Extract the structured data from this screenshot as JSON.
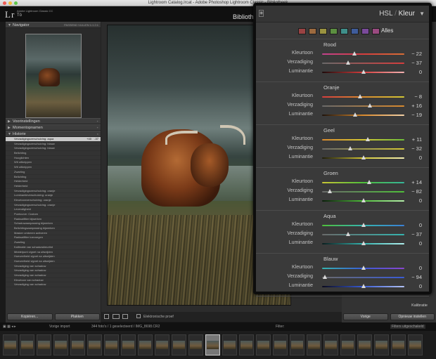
{
  "window": {
    "title": "Lightroom Catalog.lrcat - Adobe Photoshop Lightroom Classic - Bibliotheek"
  },
  "identity": {
    "logo": "Lr",
    "app_name": "Adobe Lightroom Classic CC",
    "user": "Tó",
    "module": "Biblioth"
  },
  "left_panel": {
    "navigator": {
      "label": "Navigator",
      "options": "PASSEND VULLEN 1:1 2:1"
    },
    "presets_label": "Voorinstellingen",
    "snapshots_label": "Momentopnamen",
    "history_label": "Historie",
    "history": [
      {
        "label": "Verzadigingsverschuiving: aqua",
        "v1": "+40",
        "v2": "-37",
        "selected": true
      },
      {
        "label": "Verzadigingsverschuiving: blauw",
        "v1": "",
        "v2": ""
      },
      {
        "label": "Verzadigingsverschuiving: blauw",
        "v1": "",
        "v2": ""
      },
      {
        "label": "Belichting",
        "v1": "",
        "v2": ""
      },
      {
        "label": "Hooglichten",
        "v1": "",
        "v2": ""
      },
      {
        "label": "Wit uitknippen",
        "v1": "",
        "v2": ""
      },
      {
        "label": "Wit uitknippen",
        "v1": "",
        "v2": ""
      },
      {
        "label": "Zwarting",
        "v1": "",
        "v2": ""
      },
      {
        "label": "Belichting",
        "v1": "",
        "v2": ""
      },
      {
        "label": "Helderheid",
        "v1": "",
        "v2": ""
      },
      {
        "label": "Helderheid",
        "v1": "",
        "v2": ""
      },
      {
        "label": "Verzadigingsverschuiving: oranje",
        "v1": "",
        "v2": ""
      },
      {
        "label": "Luminantieverschuiving: oranje",
        "v1": "",
        "v2": ""
      },
      {
        "label": "Kleurtoonverschuiving: oranje",
        "v1": "",
        "v2": ""
      },
      {
        "label": "Verzadigingsverschuiving: oranje",
        "v1": "",
        "v2": ""
      },
      {
        "label": "Levendigheid",
        "v1": "",
        "v2": ""
      },
      {
        "label": "Puntcurve: Custom",
        "v1": "",
        "v2": ""
      },
      {
        "label": "Radiaalfilter bijwerken",
        "v1": "",
        "v2": ""
      },
      {
        "label": "Schaduwaanpassing bijwerken",
        "v1": "",
        "v2": ""
      },
      {
        "label": "Belichtingsaanpassing bijwerken",
        "v1": "",
        "v2": ""
      },
      {
        "label": "Masker omkeren activeren",
        "v1": "",
        "v2": ""
      },
      {
        "label": "Radiaalfilter toevoegen",
        "v1": "",
        "v2": ""
      },
      {
        "label": "Zwarting",
        "v1": "",
        "v2": ""
      },
      {
        "label": "Kalibratie van schaduwkleurtint",
        "v1": "",
        "v2": ""
      },
      {
        "label": "Middelpunt vignet na uitsnijden",
        "v1": "",
        "v2": ""
      },
      {
        "label": "Hoeveelheid vignet na uitsnijden",
        "v1": "",
        "v2": ""
      },
      {
        "label": "Hoeveelheid vignet na uitsnijden",
        "v1": "",
        "v2": ""
      },
      {
        "label": "Verzadiging van schaduw",
        "v1": "",
        "v2": ""
      },
      {
        "label": "Verzadiging van schaduw",
        "v1": "",
        "v2": ""
      },
      {
        "label": "Verzadiging van schaduw",
        "v1": "",
        "v2": ""
      },
      {
        "label": "Kleurtoon van schaduw",
        "v1": "",
        "v2": ""
      },
      {
        "label": "Verzadiging van schaduw",
        "v1": "",
        "v2": ""
      }
    ],
    "copy_button": "Kopiëren...",
    "paste_button": "Plakken"
  },
  "toolbar": {
    "soft_proof_label": "Elektronische proef"
  },
  "right_panel": {
    "calibration_label": "Kalibratie",
    "previous_button": "Vorige",
    "reset_button": "Opnieuw instellen"
  },
  "filmstrip_bar": {
    "prev_import": "Vorige import",
    "info": "344 foto's / 1 geselecteerd / IMG_8698.CR2",
    "filter_label": "Filter:",
    "filter_value": "Filters uitgeschakeld"
  },
  "hsl_panel": {
    "title_hsl": "HSL",
    "title_sep": "/",
    "title_current": "Kleur",
    "all_label": "Alles",
    "swatches": [
      "#9a4343",
      "#9c6a3f",
      "#9a9340",
      "#5c8f40",
      "#3f8f8a",
      "#3f5c9a",
      "#7a4a9a",
      "#9a4a80"
    ],
    "groups": [
      {
        "name": "Rood",
        "rows": [
          {
            "label": "Kleurtoon",
            "value": "− 22",
            "amount": -22,
            "track": "linear-gradient(90deg,#c2428e,#d63d3d,#d86f36)"
          },
          {
            "label": "Verzadiging",
            "value": "− 37",
            "amount": -37,
            "track": "linear-gradient(90deg,#6a6a6a,#d63d3d)"
          },
          {
            "label": "Luminantie",
            "value": "0",
            "amount": 0,
            "track": "linear-gradient(90deg,#1e0a0a,#d63d3d,#f3b2b2)"
          }
        ]
      },
      {
        "name": "Oranje",
        "rows": [
          {
            "label": "Kleurtoon",
            "value": "− 8",
            "amount": -8,
            "track": "linear-gradient(90deg,#d63d3d,#d98a2e,#d4c834)"
          },
          {
            "label": "Verzadiging",
            "value": "+ 16",
            "amount": 16,
            "track": "linear-gradient(90deg,#6a6a6a,#d98a2e)"
          },
          {
            "label": "Luminantie",
            "value": "− 19",
            "amount": -19,
            "track": "linear-gradient(90deg,#1e120a,#d98a2e,#f4d2a8)"
          }
        ]
      },
      {
        "name": "Geel",
        "rows": [
          {
            "label": "Kleurtoon",
            "value": "+ 11",
            "amount": 11,
            "track": "linear-gradient(90deg,#d98a2e,#d4c834,#6dbd3a)"
          },
          {
            "label": "Verzadiging",
            "value": "− 32",
            "amount": -32,
            "track": "linear-gradient(90deg,#6a6a6a,#d4c834)"
          },
          {
            "label": "Luminantie",
            "value": "0",
            "amount": 0,
            "track": "linear-gradient(90deg,#1e1c0a,#d4c834,#f4efb0)"
          }
        ]
      },
      {
        "name": "Groen",
        "rows": [
          {
            "label": "Kleurtoon",
            "value": "+ 14",
            "amount": 14,
            "track": "linear-gradient(90deg,#c9c634,#4fbf3a,#35b59a)"
          },
          {
            "label": "Verzadiging",
            "value": "− 82",
            "amount": -82,
            "track": "linear-gradient(90deg,#6a6a6a,#4fbf3a)"
          },
          {
            "label": "Luminantie",
            "value": "0",
            "amount": 0,
            "track": "linear-gradient(90deg,#0a1e0a,#4fbf3a,#b6efaa)"
          }
        ]
      },
      {
        "name": "Aqua",
        "rows": [
          {
            "label": "Kleurtoon",
            "value": "0",
            "amount": 0,
            "track": "linear-gradient(90deg,#4fbf3a,#35b5b0,#3a7fd6)"
          },
          {
            "label": "Verzadiging",
            "value": "− 37",
            "amount": -37,
            "track": "linear-gradient(90deg,#6a6a6a,#35b5b0)"
          },
          {
            "label": "Luminantie",
            "value": "0",
            "amount": 0,
            "track": "linear-gradient(90deg,#0a1e1e,#35b5b0,#b0efee)"
          }
        ]
      },
      {
        "name": "Blauw",
        "rows": [
          {
            "label": "Kleurtoon",
            "value": "0",
            "amount": 0,
            "track": "linear-gradient(90deg,#35b5b0,#3a5cd6,#8a45d0)"
          },
          {
            "label": "Verzadiging",
            "value": "− 94",
            "amount": -94,
            "track": "linear-gradient(90deg,#6a6a6a,#3a5cd6)"
          },
          {
            "label": "Luminantie",
            "value": "0",
            "amount": 0,
            "track": "linear-gradient(90deg,#0a0a1e,#3a5cd6,#b3c3f5)"
          }
        ]
      }
    ]
  },
  "colors": {
    "accent_light": "#d8d8d8",
    "panel_bg": "#3a3a3a",
    "app_bg": "#1a1a1a"
  }
}
